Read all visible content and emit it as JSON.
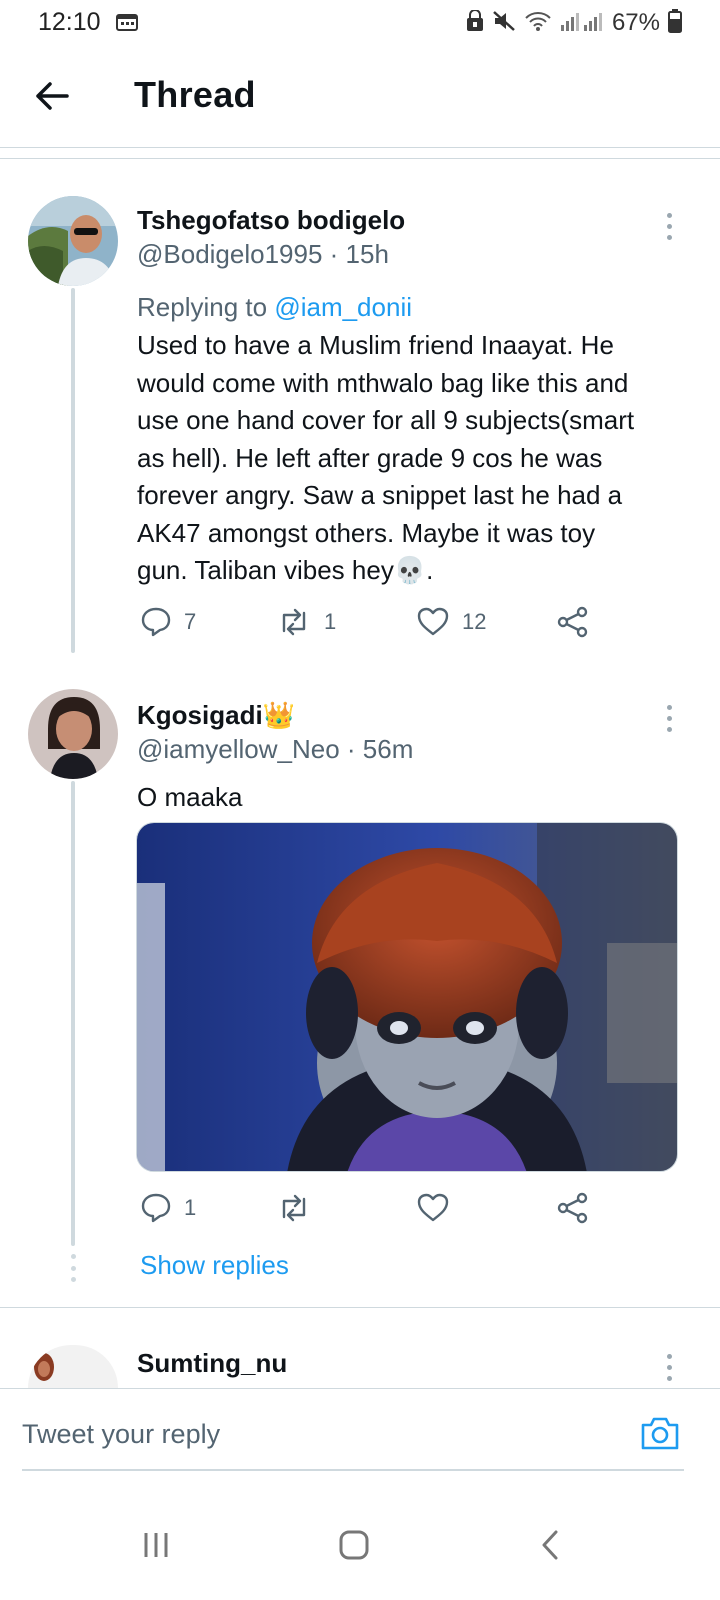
{
  "status_bar": {
    "time": "12:10",
    "battery": "67%",
    "icons": [
      "calendar-icon",
      "lock-icon",
      "mute-icon",
      "wifi-icon",
      "signal-icon",
      "battery-icon"
    ]
  },
  "header": {
    "title": "Thread",
    "back_icon": "arrow-left-icon"
  },
  "tweets": [
    {
      "name": "Tshegofatso bodigelo",
      "handle_time": "@Bodigelo1995 · 15h",
      "replying_prefix": "Replying to ",
      "replying_to": "@iam_donii",
      "text_lines": [
        "Used to have a Muslim friend Inaayat.  He",
        "would come with mthwalo  bag like this and",
        "use one hand cover for all 9 subjects(smart",
        "as hell).  He left after grade 9 cos he was",
        "forever angry. Saw a snippet  last he had a",
        "AK47 amongst others. Maybe it was toy",
        "gun. Taliban vibes hey💀."
      ],
      "replies": "7",
      "retweets": "1",
      "likes": "12"
    },
    {
      "name": "Kgosigadi👑",
      "handle_time": "@iamyellow_Neo · 56m",
      "text": "O maaka",
      "media": "image",
      "replies": "1",
      "retweets": "",
      "likes": ""
    },
    {
      "name": "Sumting_nu"
    }
  ],
  "show_replies": "Show replies",
  "reply_bar": {
    "placeholder": "Tweet your reply",
    "camera_icon": "camera-icon"
  },
  "nav": [
    "recent-apps-icon",
    "home-icon",
    "back-icon"
  ],
  "colors": {
    "link": "#1d9bf0",
    "secondary_text": "#536471",
    "divider": "#cfd9de"
  }
}
